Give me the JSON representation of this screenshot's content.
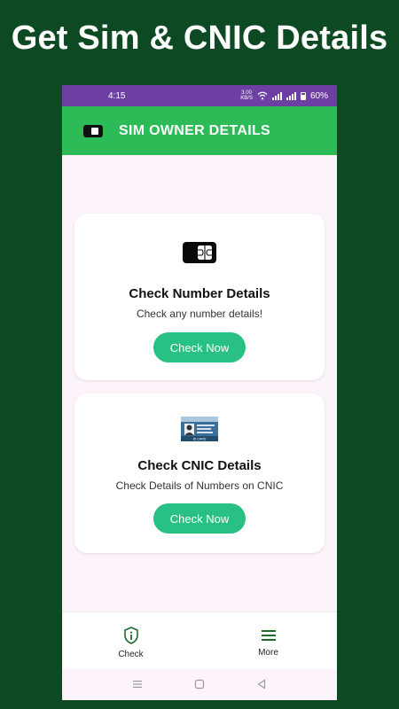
{
  "promo": {
    "title": "Get Sim & CNIC Details"
  },
  "status_bar": {
    "time": "4:15",
    "speed_value": "3.00",
    "speed_unit": "KB/S",
    "battery": "60%"
  },
  "app_bar": {
    "title": "SIM OWNER DETAILS",
    "icon": "sim-card-icon"
  },
  "cards": [
    {
      "icon": "sim-card-icon",
      "title": "Check Number Details",
      "subtitle": "Check any number details!",
      "button": "Check Now"
    },
    {
      "icon": "id-card-icon",
      "id_label": "ID CARD",
      "title": "Check CNIC Details",
      "subtitle": "Check Details of Numbers on CNIC",
      "button": "Check Now"
    }
  ],
  "bottom_nav": [
    {
      "label": "Check",
      "icon": "info-shield-icon"
    },
    {
      "label": "More",
      "icon": "menu-icon"
    }
  ],
  "colors": {
    "background": "#0d4a24",
    "status_bar": "#6e3fa3",
    "app_bar": "#2dbb57",
    "button": "#28c183",
    "nav_active": "#1f6b2e"
  }
}
